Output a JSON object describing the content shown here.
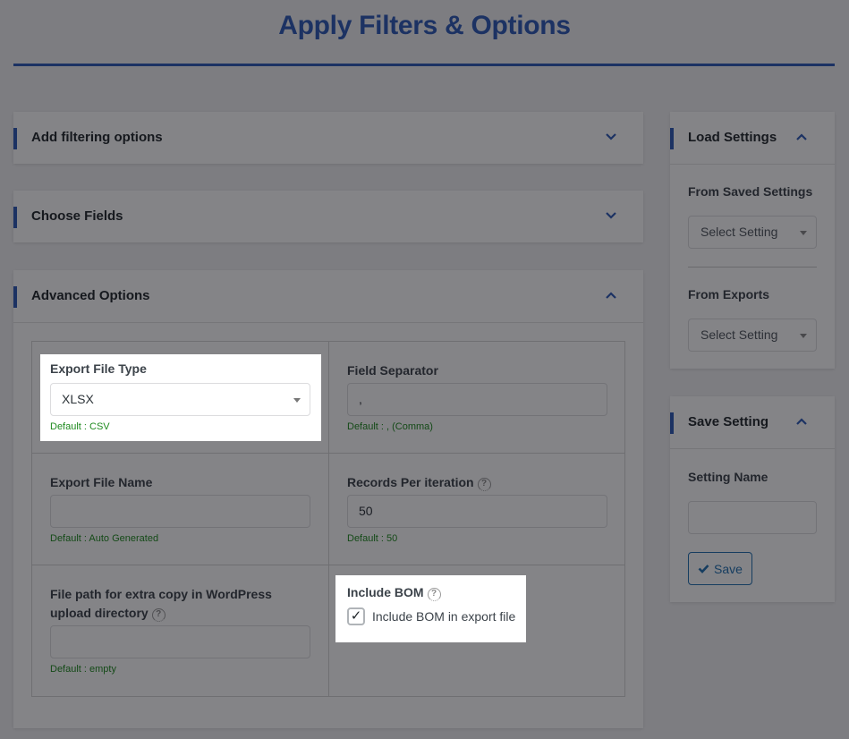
{
  "page": {
    "title": "Apply Filters & Options"
  },
  "accent_color": "#2f5bb7",
  "main": {
    "panels": [
      {
        "title": "Add filtering options",
        "state": "collapsed",
        "icon": "chevron-down-icon"
      },
      {
        "title": "Choose Fields",
        "state": "collapsed",
        "icon": "chevron-down-icon"
      },
      {
        "title": "Advanced Options",
        "state": "expanded",
        "icon": "chevron-up-icon"
      }
    ],
    "advanced": {
      "export_file_type": {
        "label": "Export File Type",
        "value": "XLSX",
        "hint": "Default : CSV"
      },
      "field_separator": {
        "label": "Field Separator",
        "value": ",",
        "hint": "Default : , (Comma)"
      },
      "export_file_name": {
        "label": "Export File Name",
        "value": "",
        "hint": "Default : Auto Generated"
      },
      "records_per_iteration": {
        "label": "Records Per iteration",
        "value": "50",
        "hint": "Default : 50",
        "help_icon": "?"
      },
      "file_path": {
        "label": "File path for extra copy in WordPress upload directory",
        "value": "",
        "hint": "Default : empty",
        "help_icon": "?"
      },
      "include_bom": {
        "label": "Include BOM",
        "checkbox_label": "Include BOM in export file",
        "checked": true,
        "check_glyph": "✓",
        "help_icon": "?"
      }
    }
  },
  "sidebar": {
    "load_settings": {
      "title": "Load Settings",
      "from_saved_label": "From Saved Settings",
      "from_saved_value": "Select Setting",
      "from_exports_label": "From Exports",
      "from_exports_value": "Select Setting"
    },
    "save_setting": {
      "title": "Save Setting",
      "name_label": "Setting Name",
      "name_value": "",
      "save_button": "Save"
    }
  }
}
